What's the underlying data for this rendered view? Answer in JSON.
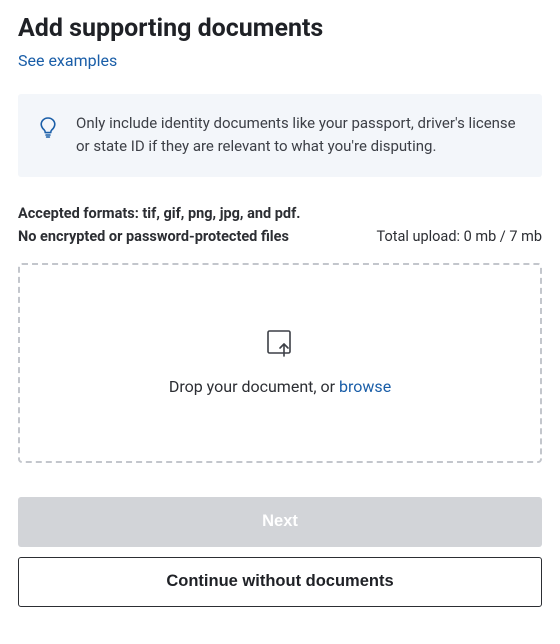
{
  "header": {
    "title": "Add supporting documents",
    "examples_link": "See examples"
  },
  "info": {
    "text": "Only include identity documents like your passport, driver's license or state ID if they are relevant to what you're disputing."
  },
  "formats": {
    "label": "Accepted formats: tif, gif, png, jpg, and pdf."
  },
  "restrictions": {
    "no_encrypted": "No encrypted or password-protected files",
    "total_upload": "Total upload: 0 mb / 7 mb"
  },
  "dropzone": {
    "prefix": "Drop your document, or ",
    "browse": "browse"
  },
  "buttons": {
    "next": "Next",
    "continue_without": "Continue without documents"
  }
}
